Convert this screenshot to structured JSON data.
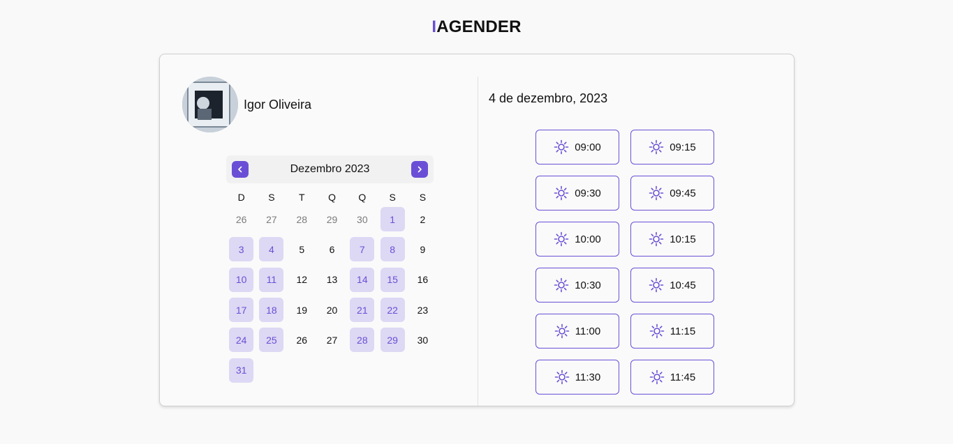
{
  "logo": {
    "accent": "I",
    "rest": "AGENDER"
  },
  "profile": {
    "name": "Igor Oliveira"
  },
  "calendar": {
    "month_label": "Dezembro 2023",
    "weekdays": [
      "D",
      "S",
      "T",
      "Q",
      "Q",
      "S",
      "S"
    ],
    "days": [
      {
        "label": "26",
        "state": "muted"
      },
      {
        "label": "27",
        "state": "muted"
      },
      {
        "label": "28",
        "state": "muted"
      },
      {
        "label": "29",
        "state": "muted"
      },
      {
        "label": "30",
        "state": "muted"
      },
      {
        "label": "1",
        "state": "avail"
      },
      {
        "label": "2",
        "state": "normal"
      },
      {
        "label": "3",
        "state": "avail"
      },
      {
        "label": "4",
        "state": "avail"
      },
      {
        "label": "5",
        "state": "normal"
      },
      {
        "label": "6",
        "state": "normal"
      },
      {
        "label": "7",
        "state": "avail"
      },
      {
        "label": "8",
        "state": "avail"
      },
      {
        "label": "9",
        "state": "normal"
      },
      {
        "label": "10",
        "state": "avail"
      },
      {
        "label": "11",
        "state": "avail"
      },
      {
        "label": "12",
        "state": "normal"
      },
      {
        "label": "13",
        "state": "normal"
      },
      {
        "label": "14",
        "state": "avail"
      },
      {
        "label": "15",
        "state": "avail"
      },
      {
        "label": "16",
        "state": "normal"
      },
      {
        "label": "17",
        "state": "avail"
      },
      {
        "label": "18",
        "state": "avail"
      },
      {
        "label": "19",
        "state": "normal"
      },
      {
        "label": "20",
        "state": "normal"
      },
      {
        "label": "21",
        "state": "avail"
      },
      {
        "label": "22",
        "state": "avail"
      },
      {
        "label": "23",
        "state": "normal"
      },
      {
        "label": "24",
        "state": "avail"
      },
      {
        "label": "25",
        "state": "avail"
      },
      {
        "label": "26",
        "state": "normal"
      },
      {
        "label": "27",
        "state": "normal"
      },
      {
        "label": "28",
        "state": "avail"
      },
      {
        "label": "29",
        "state": "avail"
      },
      {
        "label": "30",
        "state": "normal"
      },
      {
        "label": "31",
        "state": "avail"
      }
    ]
  },
  "schedule": {
    "date_title": "4 de dezembro, 2023",
    "slots": [
      "09:00",
      "09:15",
      "09:30",
      "09:45",
      "10:00",
      "10:15",
      "10:30",
      "10:45",
      "11:00",
      "11:15",
      "11:30",
      "11:45"
    ],
    "slot_icon": "sun-icon"
  },
  "colors": {
    "accent": "#6a4fd6",
    "available_bg": "#ddd8f4"
  }
}
